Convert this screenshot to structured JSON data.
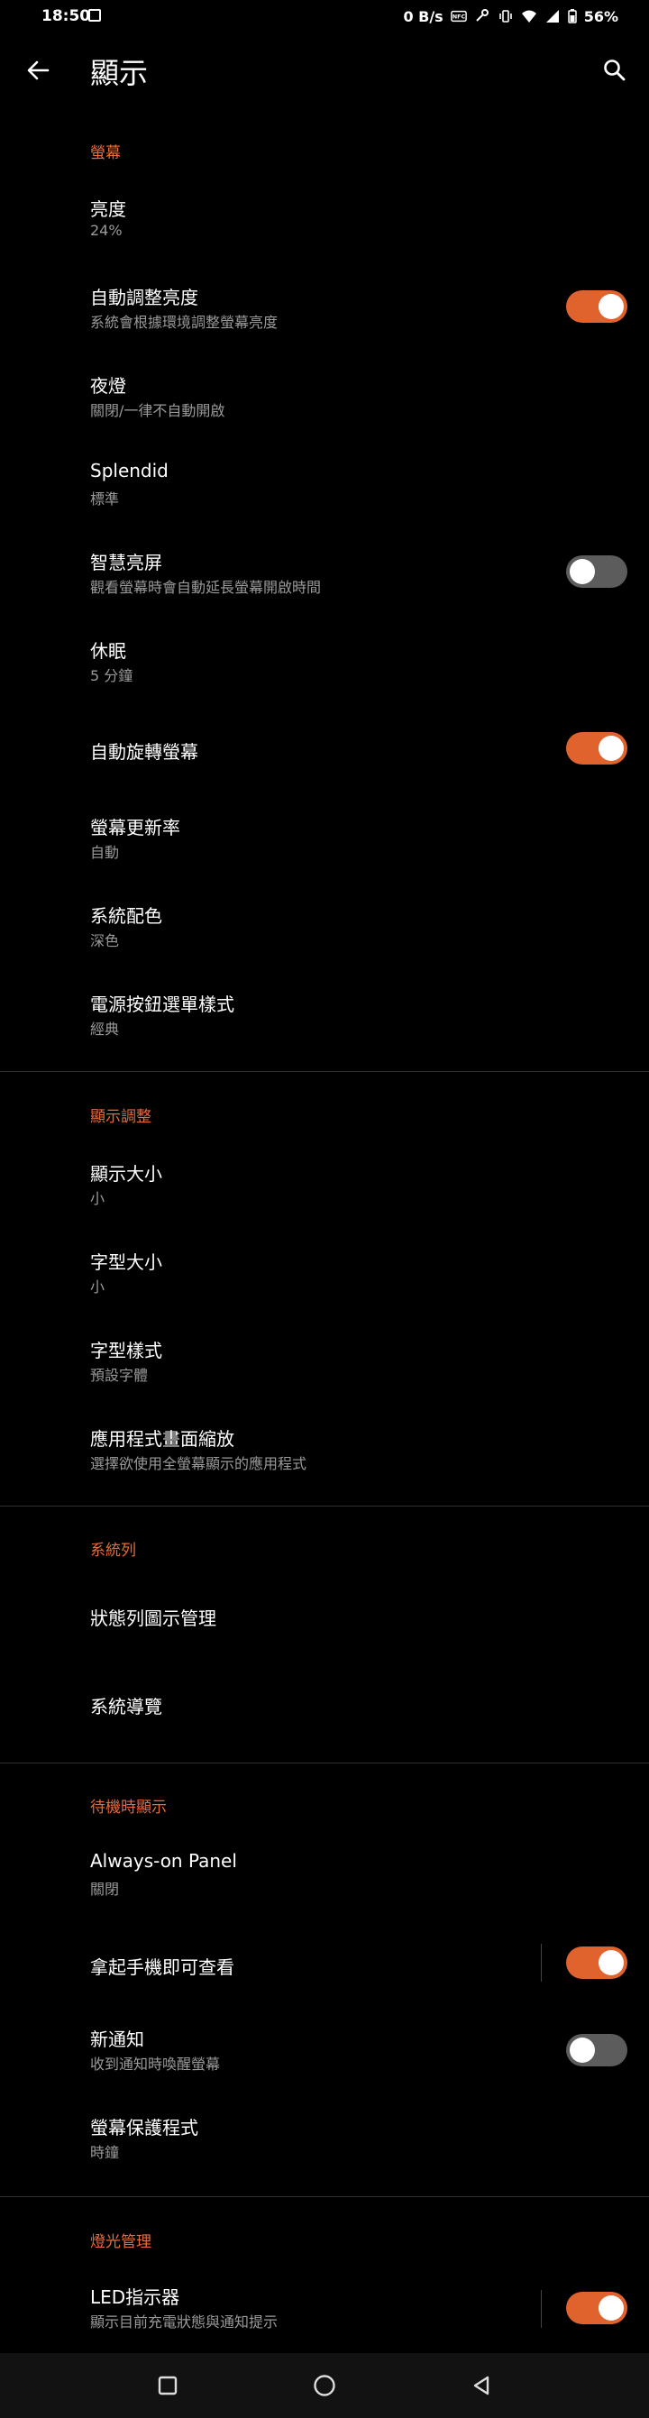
{
  "status_bar": {
    "time": "18:50",
    "net_speed": "0 B/s",
    "battery": "56%"
  },
  "app_bar": {
    "title": "顯示"
  },
  "sections": {
    "screen": {
      "header": "螢幕",
      "brightness": {
        "title": "亮度",
        "sub": "24%"
      },
      "adaptive_brightness": {
        "title": "自動調整亮度",
        "sub": "系統會根據環境調整螢幕亮度",
        "on": true
      },
      "night_light": {
        "title": "夜燈",
        "sub": "關閉/一律不自動開啟"
      },
      "splendid": {
        "title": "Splendid",
        "sub": "標準"
      },
      "smart_screen": {
        "title": "智慧亮屏",
        "sub": "觀看螢幕時會自動延長螢幕開啟時間",
        "on": false
      },
      "sleep": {
        "title": "休眠",
        "sub": "5 分鐘"
      },
      "auto_rotate": {
        "title": "自動旋轉螢幕",
        "on": true
      },
      "refresh_rate": {
        "title": "螢幕更新率",
        "sub": "自動"
      },
      "system_color": {
        "title": "系統配色",
        "sub": "深色"
      },
      "power_menu": {
        "title": "電源按鈕選單樣式",
        "sub": "經典"
      }
    },
    "display_adjust": {
      "header": "顯示調整",
      "display_size": {
        "title": "顯示大小",
        "sub": "小"
      },
      "font_size": {
        "title": "字型大小",
        "sub": "小"
      },
      "font_style": {
        "title": "字型樣式",
        "sub": "預設字體"
      },
      "app_scaling": {
        "title": "應用程式畫面縮放",
        "sub": "選擇欲使用全螢幕顯示的應用程式"
      }
    },
    "system_bar": {
      "header": "系統列",
      "status_icons": {
        "title": "狀態列圖示管理"
      },
      "navigation": {
        "title": "系統導覽"
      }
    },
    "standby": {
      "header": "待機時顯示",
      "always_on": {
        "title": "Always-on Panel",
        "sub": "關閉"
      },
      "lift_to_check": {
        "title": "拿起手機即可查看",
        "on": true
      },
      "new_notification": {
        "title": "新通知",
        "sub": "收到通知時喚醒螢幕",
        "on": false
      },
      "screensaver": {
        "title": "螢幕保護程式",
        "sub": "時鐘"
      }
    },
    "lighting": {
      "header": "燈光管理",
      "led": {
        "title": "LED指示器",
        "sub": "顯示目前充電狀態與通知提示",
        "on": true
      }
    }
  },
  "colors": {
    "accent": "#e0632e",
    "section_header": "#e86b3a",
    "switch_off": "#5c5c5c"
  },
  "icons": {
    "back": "arrow-left",
    "search": "magnifier",
    "nav_recent": "square",
    "nav_home": "circle",
    "nav_back": "triangle-left"
  }
}
